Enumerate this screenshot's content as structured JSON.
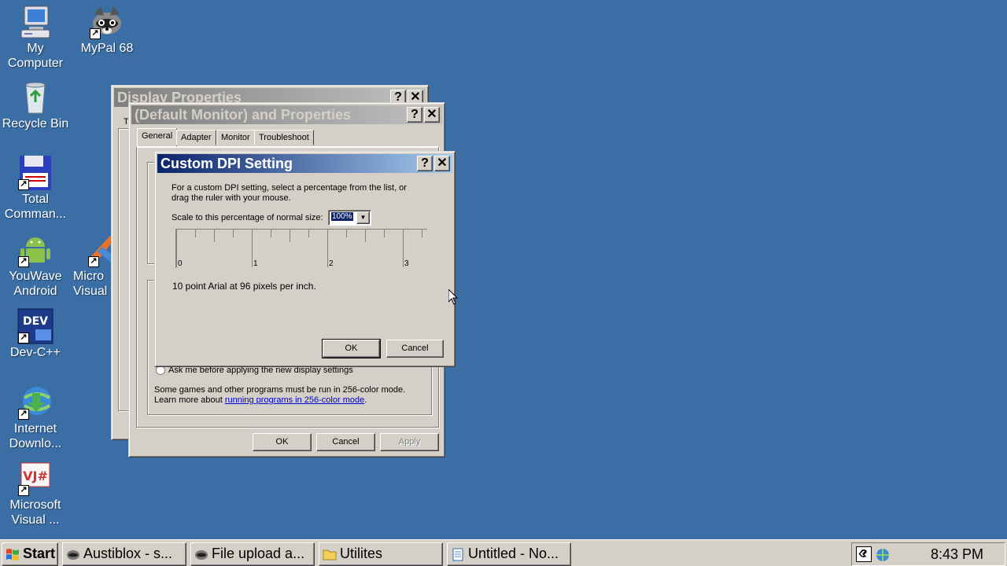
{
  "desktop": {
    "icons": [
      {
        "label": "My\nComputer",
        "icon": "my-computer-icon"
      },
      {
        "label": "MyPal 68",
        "icon": "mypal-icon"
      },
      {
        "label": "Recycle Bin",
        "icon": "recycle-bin-icon"
      },
      {
        "label": "Total\nComman...",
        "icon": "total-commander-icon"
      },
      {
        "label": "YouWave\nAndroid",
        "icon": "android-icon"
      },
      {
        "label": "Micro\nVisual",
        "icon": "visual-studio-icon"
      },
      {
        "label": "Dev-C++",
        "icon": "dev-cpp-icon"
      },
      {
        "label": "Internet\nDownlo...",
        "icon": "internet-download-manager-icon"
      },
      {
        "label": "Microsoft\nVisual ...",
        "icon": "visual-jsharp-icon"
      }
    ]
  },
  "display_properties": {
    "title": "Display Properties",
    "help_glyph": "?",
    "close_glyph": "✕",
    "partial_tab": "T"
  },
  "monitor_properties": {
    "title": "(Default Monitor) and  Properties",
    "tabs": [
      "General",
      "Adapter",
      "Monitor",
      "Troubleshoot"
    ],
    "ask_radio_label": "Ask me before applying the new display settings",
    "color_note": "Some games and other programs must be run in 256-color mode.",
    "learn_prefix": "Learn more about ",
    "learn_link": "running programs in 256-color mode",
    "learn_suffix": ".",
    "ok_label": "OK",
    "cancel_label": "Cancel",
    "apply_label": "Apply"
  },
  "custom_dpi": {
    "title": "Custom DPI Setting",
    "description": "For a custom DPI setting, select a percentage from the list, or drag the ruler with your mouse.",
    "scale_label": "Scale to this percentage of normal size:",
    "scale_value": "100%",
    "ruler_labels": [
      "0",
      "1",
      "2",
      "3"
    ],
    "sample_text": "10 point Arial at 96 pixels per inch.",
    "ok_label": "OK",
    "cancel_label": "Cancel"
  },
  "taskbar": {
    "start_label": "Start",
    "items": [
      {
        "label": "Austiblox - s...",
        "icon": "mypal-icon"
      },
      {
        "label": "File upload a...",
        "icon": "mypal-icon"
      },
      {
        "label": "Utilites",
        "icon": "folder-icon"
      },
      {
        "label": "Untitled - No...",
        "icon": "notepad-icon"
      }
    ],
    "clock": "8:43 PM",
    "tray_chevron": "«"
  },
  "colors": {
    "desktop": "#3a6ea5",
    "active_title_start": "#0a246a",
    "active_title_end": "#a6caf0",
    "face": "#d4d0c8"
  }
}
